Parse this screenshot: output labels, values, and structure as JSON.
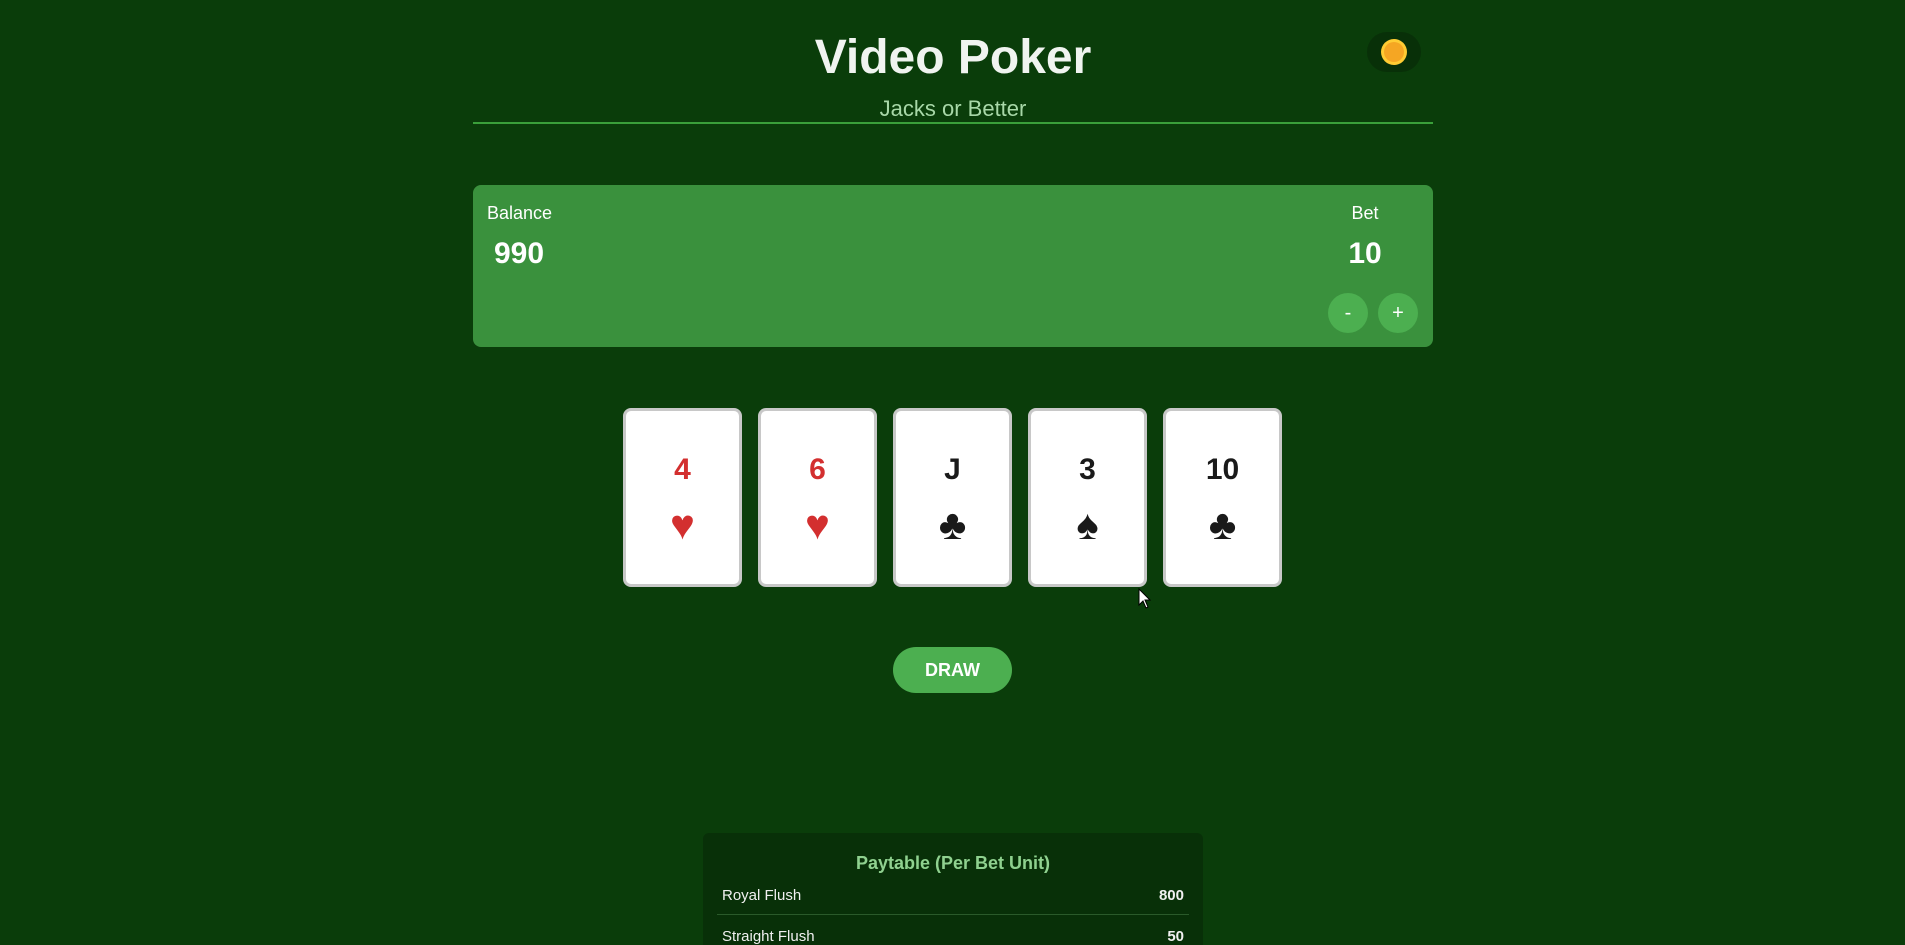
{
  "header": {
    "title": "Video Poker",
    "subtitle": "Jacks or Better",
    "theme_icon": "sun-icon"
  },
  "info": {
    "balance_label": "Balance",
    "balance_value": "990",
    "bet_label": "Bet",
    "bet_value": "10",
    "bet_minus": "-",
    "bet_plus": "+"
  },
  "cards": [
    {
      "rank": "4",
      "suit": "♥",
      "color": "red"
    },
    {
      "rank": "6",
      "suit": "♥",
      "color": "red"
    },
    {
      "rank": "J",
      "suit": "♣",
      "color": "black"
    },
    {
      "rank": "3",
      "suit": "♠",
      "color": "black"
    },
    {
      "rank": "10",
      "suit": "♣",
      "color": "black"
    }
  ],
  "actions": {
    "draw_label": "DRAW"
  },
  "paytable": {
    "title": "Paytable (Per Bet Unit)",
    "rows": [
      {
        "hand": "Royal Flush",
        "payout": "800"
      },
      {
        "hand": "Straight Flush",
        "payout": "50"
      }
    ]
  },
  "colors": {
    "background": "#0a3d0a",
    "panel": "#3a913d",
    "accent": "#4caf50",
    "red_suit": "#d32f2f"
  }
}
